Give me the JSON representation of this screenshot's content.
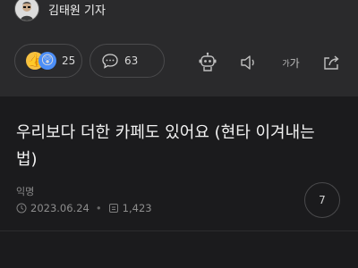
{
  "author": {
    "name": "김태원 기자"
  },
  "reactions": {
    "like_count": "25",
    "comment_count": "63"
  },
  "post": {
    "title_line1": "우리보다 더한 카페도 있어요 (현타 이겨내는",
    "title_line2": "법)",
    "author_label": "익명",
    "date": "2023.06.24",
    "views": "1,423",
    "comments": "7"
  },
  "toolbar": {
    "font_size_label_small": "가",
    "font_size_label_large": "가"
  },
  "icons": [
    "robot-icon",
    "speaker-icon",
    "font-size-icon",
    "share-icon",
    "speech-bubble-icon",
    "clock-icon",
    "views-icon"
  ],
  "colors": {
    "background": "#1b1b1d",
    "header": "#2a2a2c",
    "text": "#f2f2f2",
    "muted": "#8d8d8d"
  }
}
